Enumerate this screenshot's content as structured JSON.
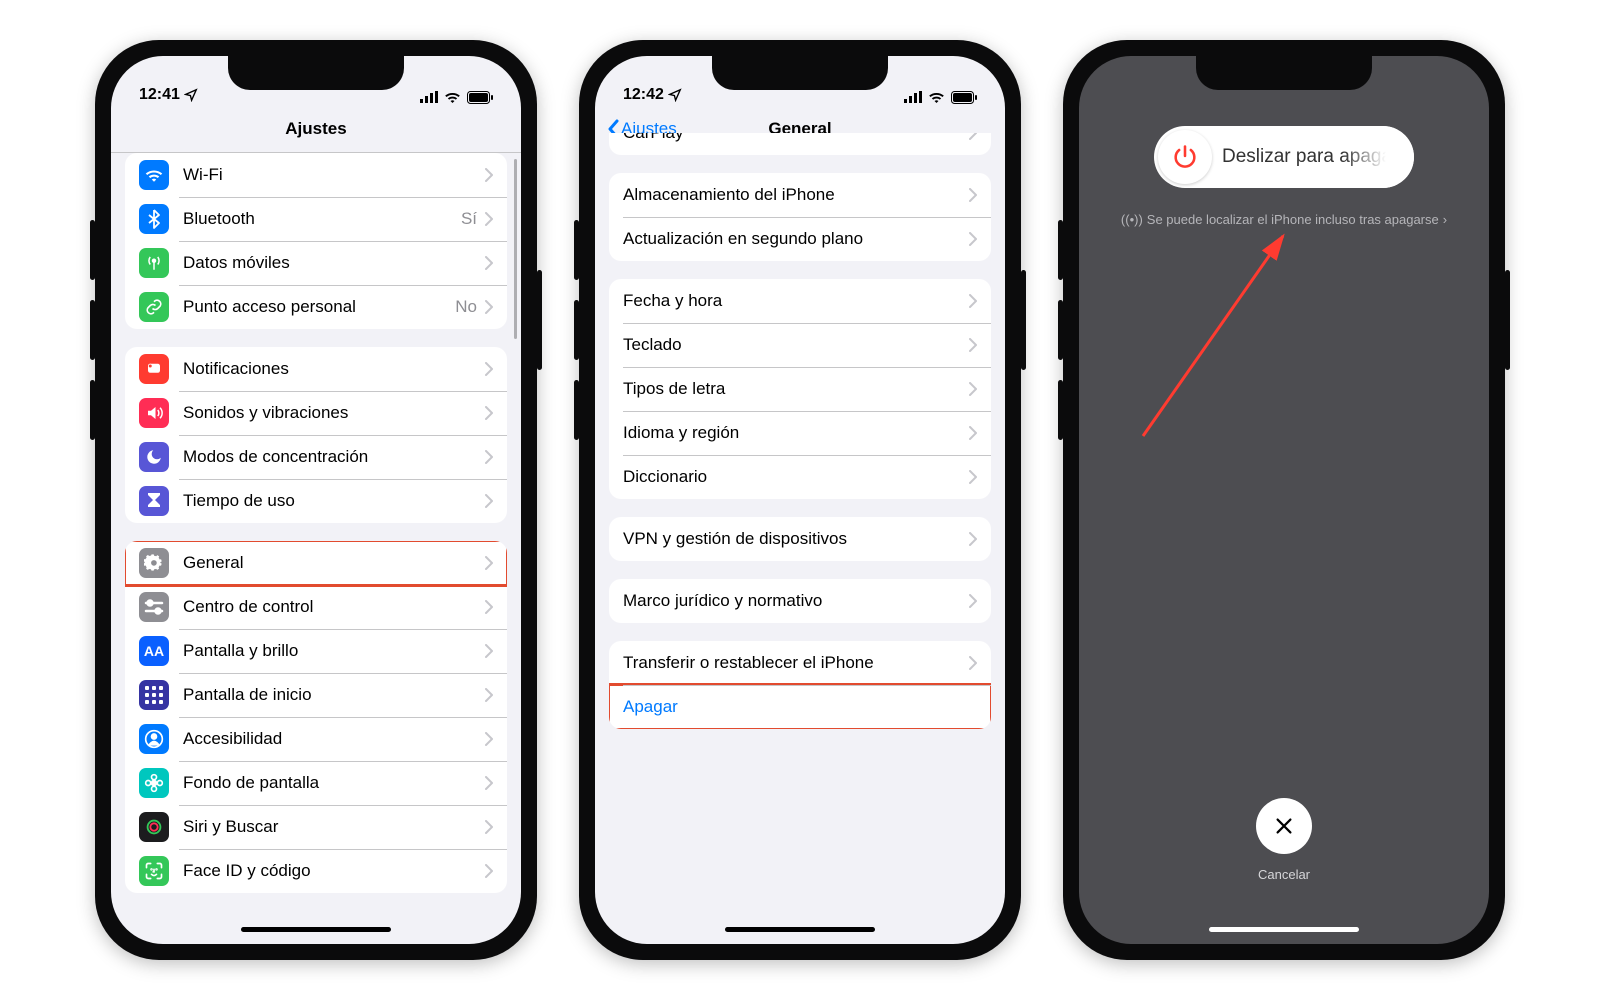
{
  "phone1": {
    "time": "12:41",
    "title": "Ajustes",
    "groups": [
      {
        "first": true,
        "items": [
          {
            "name": "wifi",
            "icon": "wifi",
            "color": "#007aff",
            "label": "Wi-Fi"
          },
          {
            "name": "bluetooth",
            "icon": "bt",
            "color": "#007aff",
            "label": "Bluetooth",
            "value": "Sí"
          },
          {
            "name": "cellular",
            "icon": "antenna",
            "color": "#34c759",
            "label": "Datos móviles"
          },
          {
            "name": "hotspot",
            "icon": "link",
            "color": "#34c759",
            "label": "Punto acceso personal",
            "value": "No"
          }
        ]
      },
      {
        "items": [
          {
            "name": "notifications",
            "icon": "bell",
            "color": "#ff3b30",
            "label": "Notificaciones"
          },
          {
            "name": "sounds",
            "icon": "speaker",
            "color": "#ff2d55",
            "label": "Sonidos y vibraciones"
          },
          {
            "name": "focus",
            "icon": "moon",
            "color": "#5856d6",
            "label": "Modos de concentración"
          },
          {
            "name": "screentime",
            "icon": "hourglass",
            "color": "#5856d6",
            "label": "Tiempo de uso"
          }
        ]
      },
      {
        "items": [
          {
            "name": "general",
            "icon": "gear",
            "color": "#8e8e93",
            "label": "General",
            "highlight": true
          },
          {
            "name": "control-center",
            "icon": "switches",
            "color": "#8e8e93",
            "label": "Centro de control"
          },
          {
            "name": "display",
            "icon": "AA",
            "color": "#0a60ff",
            "label": "Pantalla y brillo"
          },
          {
            "name": "home-screen",
            "icon": "grid",
            "color": "#3634a3",
            "label": "Pantalla de inicio"
          },
          {
            "name": "accessibility",
            "icon": "person",
            "color": "#007aff",
            "label": "Accesibilidad"
          },
          {
            "name": "wallpaper",
            "icon": "flower",
            "color": "#00c7be",
            "label": "Fondo de pantalla"
          },
          {
            "name": "siri",
            "icon": "siri",
            "color": "#1c1c1e",
            "label": "Siri y Buscar"
          },
          {
            "name": "faceid",
            "icon": "faceid",
            "color": "#34c759",
            "label": "Face ID y código"
          }
        ]
      }
    ]
  },
  "phone2": {
    "time": "12:42",
    "back": "Ajustes",
    "title": "General",
    "groups": [
      {
        "first": true,
        "cut": true,
        "items": [
          {
            "name": "carplay",
            "label": "CarPlay"
          }
        ]
      },
      {
        "items": [
          {
            "name": "storage",
            "label": "Almacenamiento del iPhone"
          },
          {
            "name": "bg-refresh",
            "label": "Actualización en segundo plano"
          }
        ]
      },
      {
        "items": [
          {
            "name": "date-time",
            "label": "Fecha y hora"
          },
          {
            "name": "keyboard",
            "label": "Teclado"
          },
          {
            "name": "fonts",
            "label": "Tipos de letra"
          },
          {
            "name": "language",
            "label": "Idioma y región"
          },
          {
            "name": "dictionary",
            "label": "Diccionario"
          }
        ]
      },
      {
        "items": [
          {
            "name": "vpn",
            "label": "VPN y gestión de dispositivos"
          }
        ]
      },
      {
        "items": [
          {
            "name": "legal",
            "label": "Marco jurídico y normativo"
          }
        ]
      },
      {
        "items": [
          {
            "name": "transfer",
            "label": "Transferir o restablecer el iPhone"
          },
          {
            "name": "shutdown",
            "label": "Apagar",
            "blue": true,
            "nochev": true,
            "highlight": true
          }
        ]
      }
    ]
  },
  "phone3": {
    "slide_text": "Deslizar para apagar",
    "findmy": "Se puede localizar el iPhone incluso tras apagarse",
    "cancel": "Cancelar"
  }
}
